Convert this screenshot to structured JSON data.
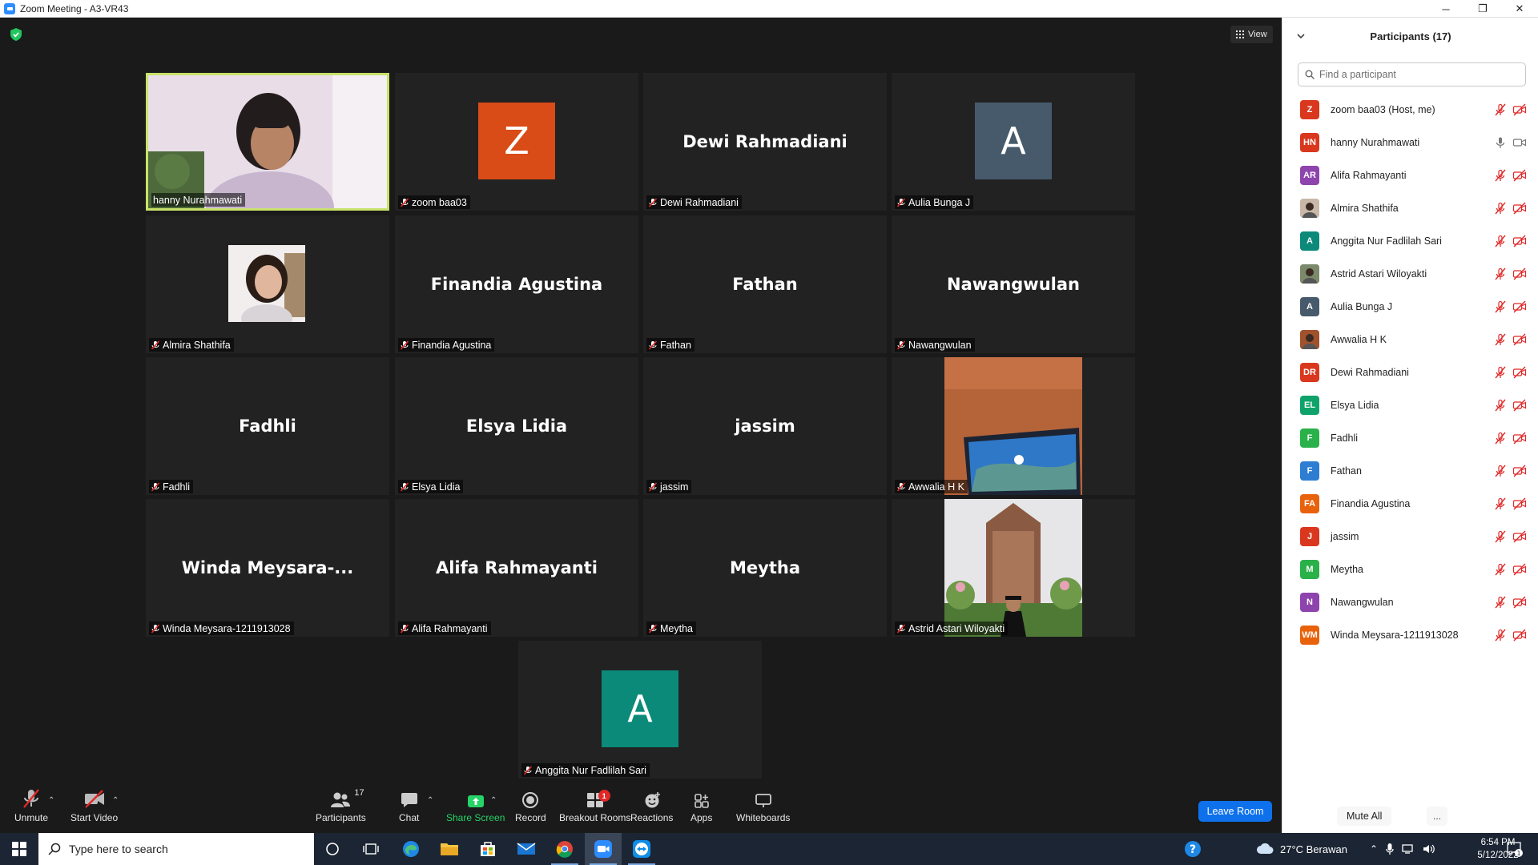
{
  "window": {
    "title": "Zoom Meeting - A3-VR43",
    "minimize": "─",
    "restore": "❐",
    "close": "✕"
  },
  "view_button": {
    "label": "View"
  },
  "tiles": [
    {
      "name": "hanny Nurahmawati",
      "kind": "photo",
      "active": true
    },
    {
      "name": "zoom baa03",
      "kind": "avatar",
      "letter": "Z",
      "color": "#d94b17"
    },
    {
      "name": "Dewi Rahmadiani",
      "kind": "text",
      "display": "Dewi Rahmadiani"
    },
    {
      "name": "Aulia Bunga J",
      "kind": "avatar",
      "letter": "A",
      "color": "#465a6b"
    },
    {
      "name": "Almira Shathifa",
      "kind": "photo"
    },
    {
      "name": "Finandia Agustina",
      "kind": "text",
      "display": "Finandia Agustina"
    },
    {
      "name": "Fathan",
      "kind": "text",
      "display": "Fathan"
    },
    {
      "name": "Nawangwulan",
      "kind": "text",
      "display": "Nawangwulan"
    },
    {
      "name": "Fadhli",
      "kind": "text",
      "display": "Fadhli"
    },
    {
      "name": "Elsya Lidia",
      "kind": "text",
      "display": "Elsya Lidia"
    },
    {
      "name": "jassim",
      "kind": "text",
      "display": "jassim"
    },
    {
      "name": "Awwalia H K",
      "kind": "photo"
    },
    {
      "name": "Winda Meysara-1211913028",
      "kind": "text",
      "display": "Winda  Meysara-..."
    },
    {
      "name": "Alifa Rahmayanti",
      "kind": "text",
      "display": "Alifa Rahmayanti"
    },
    {
      "name": "Meytha",
      "kind": "text",
      "display": "Meytha"
    },
    {
      "name": "Astrid Astari Wiloyakti",
      "kind": "photo"
    },
    {
      "name": "Anggita Nur Fadlilah Sari",
      "kind": "avatar",
      "letter": "A",
      "color": "#0b8a7a"
    }
  ],
  "toolbar": {
    "unmute": "Unmute",
    "start_video": "Start Video",
    "participants": "Participants",
    "participants_count": "17",
    "chat": "Chat",
    "share_screen": "Share Screen",
    "record": "Record",
    "breakout_rooms": "Breakout Rooms",
    "breakout_badge": "1",
    "reactions": "Reactions",
    "apps": "Apps",
    "whiteboards": "Whiteboards",
    "leave": "Leave Room"
  },
  "panel": {
    "title": "Participants (17)",
    "search_placeholder": "Find a participant",
    "mute_all": "Mute All",
    "more": "...",
    "participants": [
      {
        "initials": "Z",
        "name": "zoom baa03 (Host, me)",
        "color": "#d9381e",
        "muted": true
      },
      {
        "initials": "HN",
        "name": "hanny Nurahmawati",
        "color": "#d9381e",
        "muted": false
      },
      {
        "initials": "AR",
        "name": "Alifa Rahmayanti",
        "color": "#8e44ad",
        "muted": true
      },
      {
        "initials": "",
        "name": "Almira Shathifa",
        "color": "#c9b8a8",
        "muted": true,
        "photo": true
      },
      {
        "initials": "A",
        "name": "Anggita Nur Fadlilah Sari",
        "color": "#0b8a7a",
        "muted": true
      },
      {
        "initials": "",
        "name": "Astrid Astari Wiloyakti",
        "color": "#7a8a6a",
        "muted": true,
        "photo": true
      },
      {
        "initials": "A",
        "name": "Aulia Bunga J",
        "color": "#465a6b",
        "muted": true
      },
      {
        "initials": "",
        "name": "Awwalia H K",
        "color": "#a0522d",
        "muted": true,
        "photo": true
      },
      {
        "initials": "DR",
        "name": "Dewi Rahmadiani",
        "color": "#d9381e",
        "muted": true
      },
      {
        "initials": "EL",
        "name": "Elsya Lidia",
        "color": "#0fa36b",
        "muted": true
      },
      {
        "initials": "F",
        "name": "Fadhli",
        "color": "#2ab14a",
        "muted": true
      },
      {
        "initials": "F",
        "name": "Fathan",
        "color": "#2d7dd2",
        "muted": true
      },
      {
        "initials": "FA",
        "name": "Finandia Agustina",
        "color": "#e8620c",
        "muted": true
      },
      {
        "initials": "J",
        "name": "jassim",
        "color": "#d9381e",
        "muted": true
      },
      {
        "initials": "M",
        "name": "Meytha",
        "color": "#2ab14a",
        "muted": true
      },
      {
        "initials": "N",
        "name": "Nawangwulan",
        "color": "#8e44ad",
        "muted": true
      },
      {
        "initials": "WM",
        "name": "Winda Meysara-1211913028",
        "color": "#e8620c",
        "muted": true
      }
    ]
  },
  "taskbar": {
    "search_placeholder": "Type here to search",
    "weather": "27°C  Berawan",
    "time": "6:54 PM",
    "date": "5/12/2022",
    "notification_count": "1"
  }
}
